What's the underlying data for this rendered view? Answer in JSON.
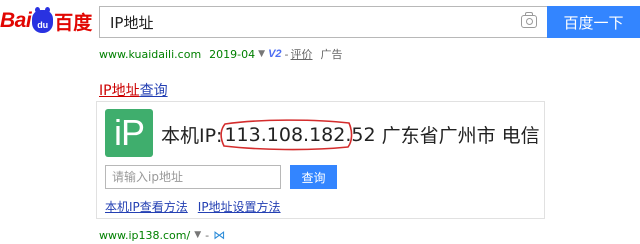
{
  "logo": {
    "bai": "Bai",
    "du_badge": "du",
    "du_text": "百度"
  },
  "search": {
    "query": "IP地址",
    "button_label": "百度一下",
    "camera_icon": "camera-icon"
  },
  "result": {
    "url": "www.kuaidaili.com",
    "date": "2019-04",
    "v_badge": "V2",
    "comment": "评价",
    "ad": "广告",
    "title_highlight": "IP地址",
    "title_rest": "查询"
  },
  "card": {
    "logo_text": "iP",
    "ip_label": "本机IP:",
    "ip_address": "113.108.182.52",
    "location": "广东省广州市 电信",
    "input_placeholder": "请输入ip地址",
    "query_button": "查询",
    "link_1": "本机IP查看方法",
    "link_2": "IP地址设置方法",
    "highlight_color": "#d42c2c"
  },
  "next_result": {
    "url": "www.ip138.com/"
  },
  "colors": {
    "brand_red": "#e10602",
    "brand_blue": "#2932e1",
    "button_blue": "#3385ff",
    "ip_green": "#3fae6d",
    "url_green": "#008000"
  }
}
